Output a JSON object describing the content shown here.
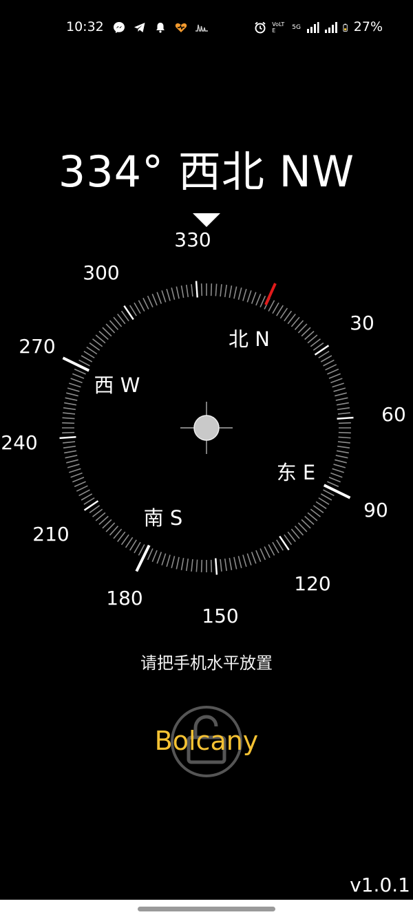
{
  "status_bar": {
    "time": "10:32",
    "left_icons": [
      "messenger-icon",
      "telegram-icon",
      "notification-bell-icon",
      "heart-rate-icon",
      "activity-wave-icon"
    ],
    "right_icons": [
      "alarm-icon",
      "volte-icon",
      "5g-signal-icon",
      "signal-strength-icon",
      "battery-icon"
    ],
    "volte_label": "VoLTE",
    "network_label": "5G",
    "battery_percent": "27%"
  },
  "compass": {
    "heading_text": "334° 西北 NW",
    "heading_degrees": 334,
    "top_marker_label": "330",
    "scale_labels": [
      "300",
      "270",
      "240",
      "210",
      "180",
      "150",
      "120",
      "90",
      "60",
      "30"
    ],
    "cardinals": {
      "north": "北 N",
      "west": "西 W",
      "south": "南 S",
      "east": "东 E"
    },
    "colors": {
      "north_indicator": "#e01b1b",
      "ticks": "#8c8c8c",
      "major_ticks": "#ffffff"
    }
  },
  "hint": "请把手机水平放置",
  "lock": {
    "icon": "unlock-icon"
  },
  "brand": "Bolcany",
  "version": "v1.0.1",
  "colors": {
    "background": "#000000",
    "brand": "#f6c233"
  }
}
